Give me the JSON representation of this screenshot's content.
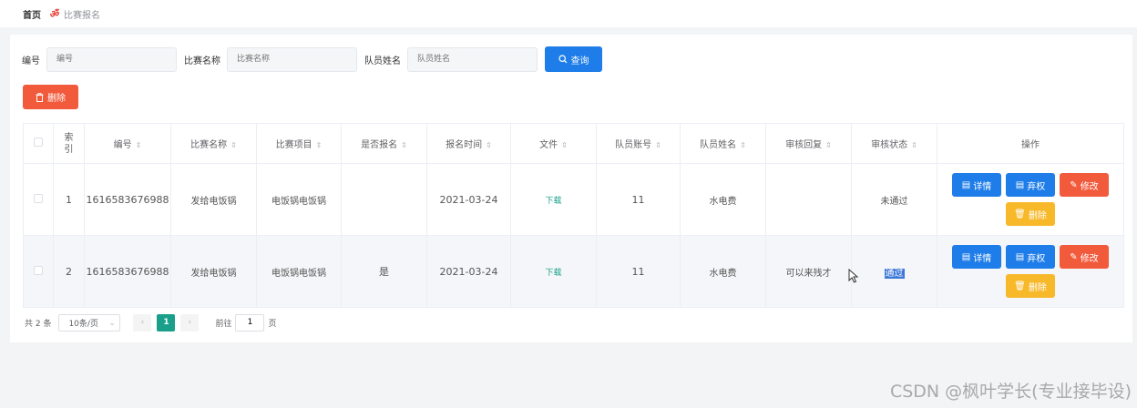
{
  "breadcrumb": {
    "home": "首页",
    "icon": "flame-icon",
    "current": "比赛报名"
  },
  "search": {
    "fields": [
      {
        "label": "编号",
        "placeholder": "编号"
      },
      {
        "label": "比赛名称",
        "placeholder": "比赛名称"
      },
      {
        "label": "队员姓名",
        "placeholder": "队员姓名"
      }
    ],
    "query_label": "查询"
  },
  "toolbar": {
    "delete_label": "删除"
  },
  "table": {
    "headers": [
      "索引",
      "编号",
      "比赛名称",
      "比赛项目",
      "是否报名",
      "报名时间",
      "文件",
      "队员账号",
      "队员姓名",
      "审核回复",
      "审核状态",
      "操作"
    ],
    "rows": [
      {
        "index": "1",
        "code": "1616583676988",
        "name": "发给电饭锅",
        "item": "电饭锅电饭锅",
        "signed": "",
        "time": "2021-03-24",
        "file": "下载",
        "account": "11",
        "member": "水电费",
        "reply": "",
        "status": "未通过"
      },
      {
        "index": "2",
        "code": "1616583676988",
        "name": "发给电饭锅",
        "item": "电饭锅电饭锅",
        "signed": "是",
        "time": "2021-03-24",
        "file": "下载",
        "account": "11",
        "member": "水电费",
        "reply": "可以来残才",
        "status": "通过"
      }
    ],
    "actions": {
      "detail": "详情",
      "abstain": "弃权",
      "edit": "修改",
      "delete": "删除"
    }
  },
  "pagination": {
    "total": "共 2 条",
    "page_size": "10条/页",
    "current_page": "1",
    "goto_label": "前往",
    "goto_value": "1",
    "page_suffix": "页"
  },
  "watermark": "CSDN @枫叶学长(专业接毕设)",
  "colors": {
    "primary": "#1e7de8",
    "danger": "#f25a3c",
    "warning": "#f7b92a",
    "success": "#1aa08a"
  }
}
